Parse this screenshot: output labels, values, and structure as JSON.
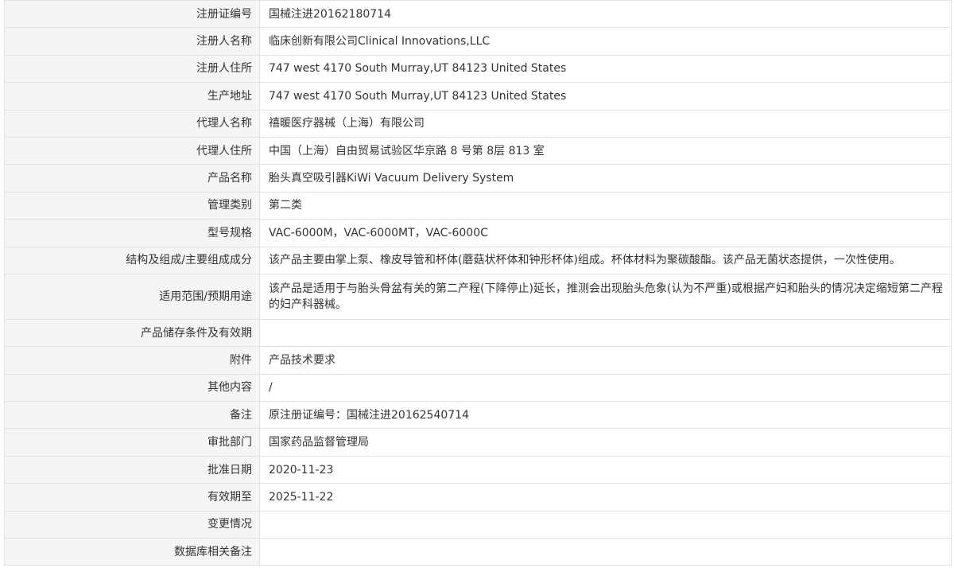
{
  "rows": [
    {
      "label": "注册证编号",
      "value": "国械注进20162180714"
    },
    {
      "label": "注册人名称",
      "value": "临床创新有限公司Clinical Innovations,LLC"
    },
    {
      "label": "注册人住所",
      "value": "747 west 4170 South Murray,UT 84123 United States"
    },
    {
      "label": "生产地址",
      "value": "747 west 4170 South Murray,UT 84123 United States"
    },
    {
      "label": "代理人名称",
      "value": "禧暖医疗器械（上海）有限公司"
    },
    {
      "label": "代理人住所",
      "value": "中国（上海）自由贸易试验区华京路 8 号第 8层 813 室"
    },
    {
      "label": "产品名称",
      "value": "胎头真空吸引器KiWi Vacuum Delivery System"
    },
    {
      "label": "管理类别",
      "value": "第二类"
    },
    {
      "label": "型号规格",
      "value": "VAC-6000M，VAC-6000MT，VAC-6000C"
    },
    {
      "label": "结构及组成/主要组成成分",
      "value": "该产品主要由掌上泵、橡皮导管和杯体(蘑菇状杯体和钟形杯体)组成。杯体材料为聚碳酸酯。该产品无菌状态提供，一次性使用。"
    },
    {
      "label": "适用范围/预期用途",
      "value": "该产品是适用于与胎头骨盆有关的第二产程(下降停止)延长，推测会出现胎头危象(认为不严重)或根据产妇和胎头的情况决定缩短第二产程的妇产科器械。"
    },
    {
      "label": "产品储存条件及有效期",
      "value": ""
    },
    {
      "label": "附件",
      "value": "产品技术要求"
    },
    {
      "label": "其他内容",
      "value": "/"
    },
    {
      "label": "备注",
      "value": "原注册证编号：国械注进20162540714"
    },
    {
      "label": "审批部门",
      "value": "国家药品监督管理局"
    },
    {
      "label": "批准日期",
      "value": "2020-11-23"
    },
    {
      "label": "有效期至",
      "value": "2025-11-22"
    },
    {
      "label": "变更情况",
      "value": ""
    },
    {
      "label": "数据库相关备注",
      "value": ""
    }
  ]
}
